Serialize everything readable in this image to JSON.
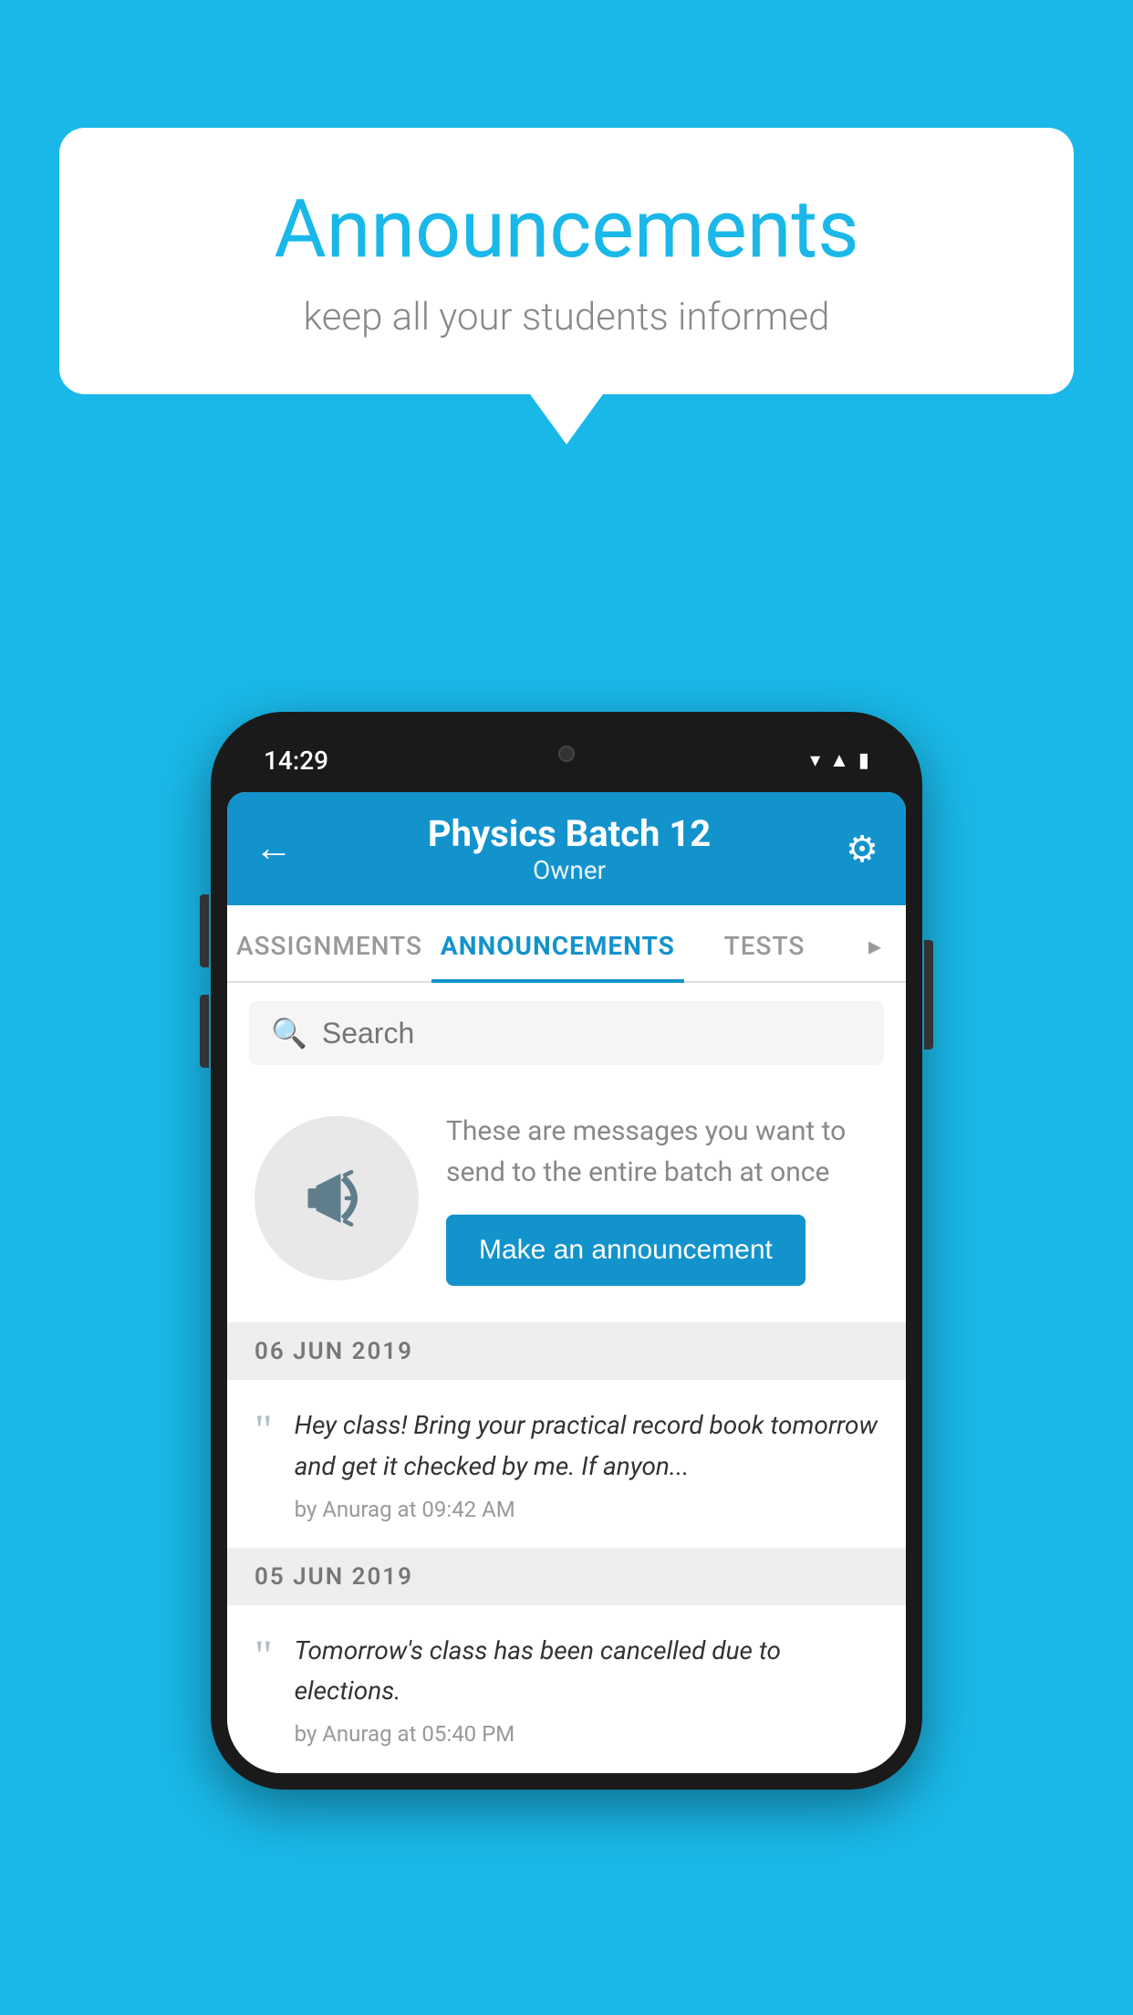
{
  "background_color": "#1ab8e8",
  "speech_bubble": {
    "title": "Announcements",
    "subtitle": "keep all your students informed"
  },
  "phone": {
    "status_bar": {
      "time": "14:29",
      "wifi_icon": "▾▾",
      "signal_icon": "▲",
      "battery_icon": "▮"
    },
    "header": {
      "back_label": "←",
      "title": "Physics Batch 12",
      "subtitle": "Owner",
      "gear_label": "⚙"
    },
    "tabs": [
      {
        "label": "ASSIGNMENTS",
        "active": false
      },
      {
        "label": "ANNOUNCEMENTS",
        "active": true
      },
      {
        "label": "TESTS",
        "active": false
      },
      {
        "label": "•",
        "active": false
      }
    ],
    "search": {
      "placeholder": "Search"
    },
    "announcement_prompt": {
      "description": "These are messages you want to send to the entire batch at once",
      "button_label": "Make an announcement"
    },
    "announcements": [
      {
        "date": "06  JUN  2019",
        "items": [
          {
            "text": "Hey class! Bring your practical record book tomorrow and get it checked by me. If anyon...",
            "meta": "by Anurag at 09:42 AM"
          }
        ]
      },
      {
        "date": "05  JUN  2019",
        "items": [
          {
            "text": "Tomorrow's class has been cancelled due to elections.",
            "meta": "by Anurag at 05:40 PM"
          }
        ]
      }
    ]
  }
}
